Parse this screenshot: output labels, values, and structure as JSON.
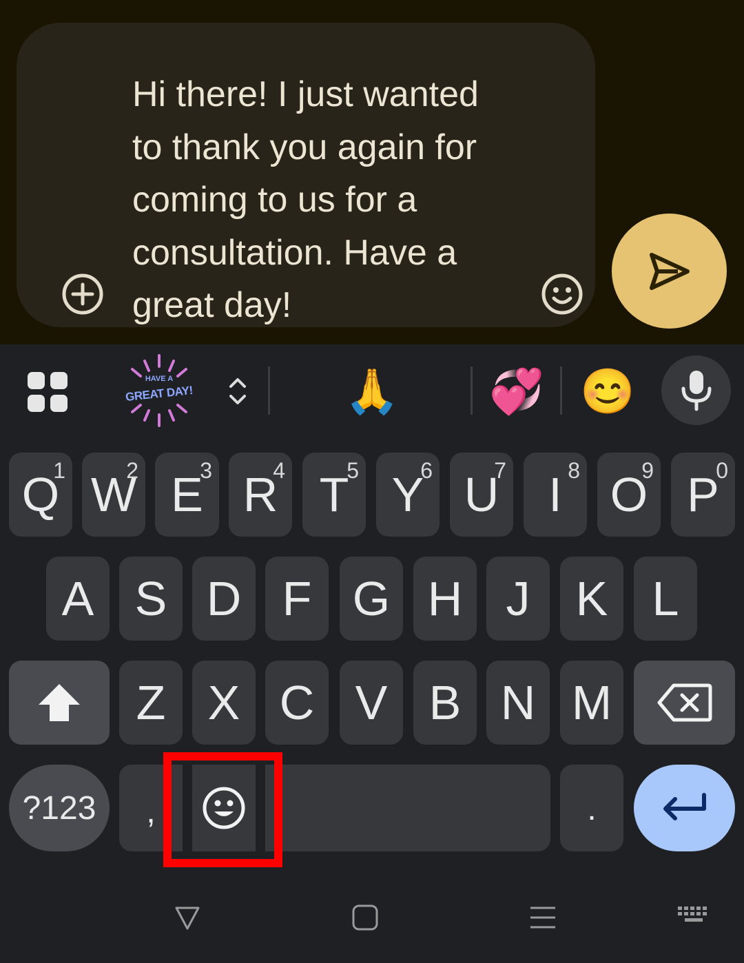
{
  "compose": {
    "message": "Hi there! I just wanted to thank you again for coming to us for a consultation. Have a great day!",
    "icons": [
      "add-circle-icon",
      "emoji-smile-icon",
      "send-icon"
    ]
  },
  "toolbar": {
    "sticker_text_top": "HAVE A",
    "sticker_text_main": "GREAT DAY!",
    "suggestion_emojis": [
      "🙏",
      "💞",
      "😊"
    ],
    "icons": [
      "apps-grid-icon",
      "expand-collapse-icon",
      "microphone-icon"
    ]
  },
  "keyboard": {
    "row1": [
      {
        "label": "Q",
        "hint": "1"
      },
      {
        "label": "W",
        "hint": "2"
      },
      {
        "label": "E",
        "hint": "3"
      },
      {
        "label": "R",
        "hint": "4"
      },
      {
        "label": "T",
        "hint": "5"
      },
      {
        "label": "Y",
        "hint": "6"
      },
      {
        "label": "U",
        "hint": "7"
      },
      {
        "label": "I",
        "hint": "8"
      },
      {
        "label": "O",
        "hint": "9"
      },
      {
        "label": "P",
        "hint": "0"
      }
    ],
    "row2": [
      "A",
      "S",
      "D",
      "F",
      "G",
      "H",
      "J",
      "K",
      "L"
    ],
    "row3": [
      "Z",
      "X",
      "C",
      "V",
      "B",
      "N",
      "M"
    ],
    "symbols_label": "?123",
    "comma_label": ",",
    "period_label": ".",
    "icons": [
      "shift-icon",
      "backspace-icon",
      "emoji-key-icon",
      "enter-icon"
    ]
  },
  "navbar": {
    "icons": [
      "back-icon",
      "home-icon",
      "recents-icon",
      "keyboard-switch-icon"
    ]
  },
  "colors": {
    "compose_bg": "#1a1502",
    "bubble": "#29241a",
    "send_button": "#e5c372",
    "keyboard_bg": "#1f2023",
    "key": "#37383c",
    "mod_key": "#4a4b50",
    "enter_key": "#a8c7fa",
    "highlight": "#ff0000"
  }
}
